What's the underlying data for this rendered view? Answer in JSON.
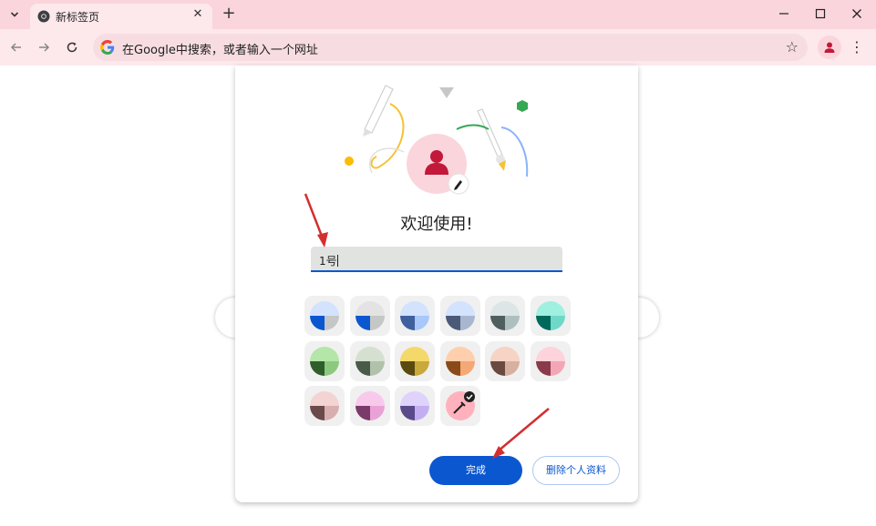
{
  "browser": {
    "tab_title": "新标签页",
    "omnibox_placeholder": "在Google中搜索，或者输入一个网址"
  },
  "dialog": {
    "welcome": "欢迎使用!",
    "name_value": "1号",
    "done_label": "完成",
    "delete_label": "删除个人资料"
  },
  "colors": {
    "accent": "#0b57d0",
    "frame": "#fbd5dc",
    "avatar_bg": "#fbd5dc",
    "avatar_icon": "#c2183a"
  },
  "swatches": [
    {
      "name": "blue-grey",
      "light": "#d3e3fd",
      "dark": "#0b57d0",
      "mid": "#c4c7c5"
    },
    {
      "name": "grey-blue",
      "light": "#e3e3e3",
      "dark": "#0b57d0",
      "mid": "#c4c7c5"
    },
    {
      "name": "light-blue",
      "light": "#d3e3fd",
      "dark": "#3f5f9e",
      "mid": "#a8c7fa"
    },
    {
      "name": "slate",
      "light": "#d3e3fd",
      "dark": "#4a5a78",
      "mid": "#a8b6d0"
    },
    {
      "name": "teal-grey",
      "light": "#dde6e6",
      "dark": "#4f5f5f",
      "mid": "#aebfbf"
    },
    {
      "name": "aqua",
      "light": "#9ff0e0",
      "dark": "#00695c",
      "mid": "#6fd8c6"
    },
    {
      "name": "green",
      "light": "#b3e6a8",
      "dark": "#2f5e2a",
      "mid": "#8cc97e"
    },
    {
      "name": "sage",
      "light": "#d5e0d0",
      "dark": "#4a5a48",
      "mid": "#b0c2aa"
    },
    {
      "name": "yellow",
      "light": "#f5d86a",
      "dark": "#5b4a10",
      "mid": "#c9a93a"
    },
    {
      "name": "orange",
      "light": "#ffcfad",
      "dark": "#8a4a1a",
      "mid": "#f4a876"
    },
    {
      "name": "peach",
      "light": "#f6d3c4",
      "dark": "#6a4a40",
      "mid": "#d8b0a0"
    },
    {
      "name": "pink",
      "light": "#ffd3dc",
      "dark": "#8a3a4a",
      "mid": "#f3a6b6"
    },
    {
      "name": "rose",
      "light": "#f4d3d3",
      "dark": "#6a4a4a",
      "mid": "#d8aeae"
    },
    {
      "name": "magenta",
      "light": "#f9c9ec",
      "dark": "#7a3a6a",
      "mid": "#eaa2d6"
    },
    {
      "name": "lavender",
      "light": "#dfd3fb",
      "dark": "#5a4a8a",
      "mid": "#c2aef0"
    }
  ],
  "custom_color": {
    "name": "custom-picker",
    "fill": "#ffb2bd",
    "selected": true
  }
}
